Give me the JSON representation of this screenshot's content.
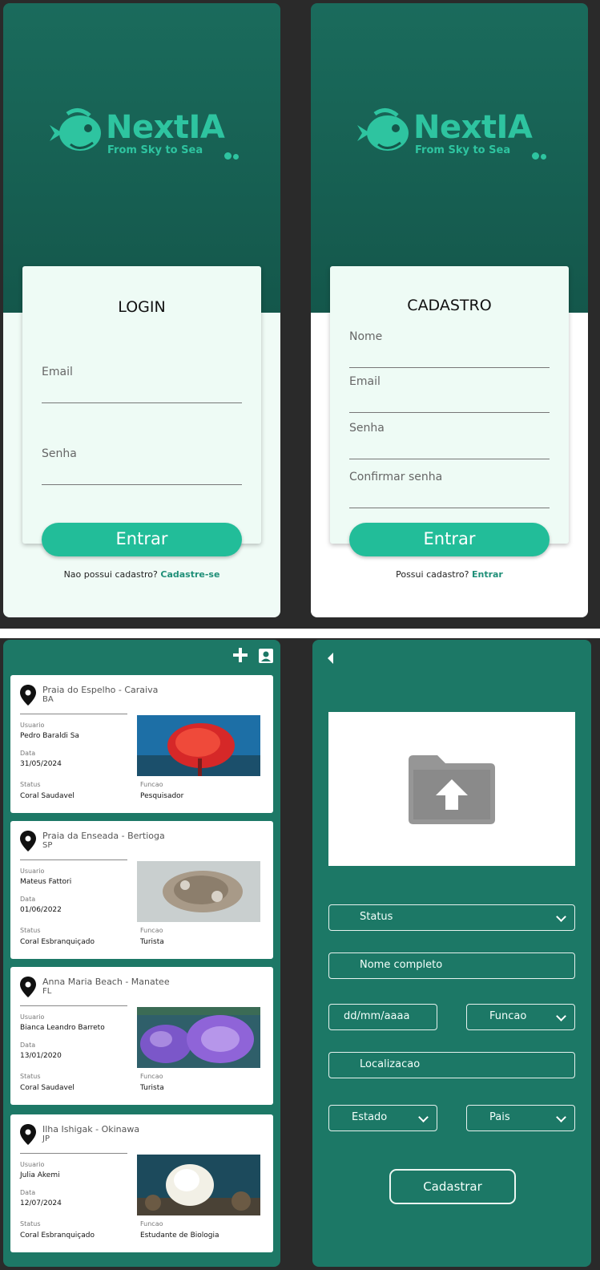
{
  "login": {
    "brand": "NextIA",
    "tagline": "From Sky to Sea",
    "title": "LOGIN",
    "email_label": "Email",
    "password_label": "Senha",
    "button": "Entrar",
    "footer_text": "Nao possui cadastro?",
    "footer_link": "Cadastre-se"
  },
  "register": {
    "brand": "NextIA",
    "tagline": "From Sky to Sea",
    "title": "CADASTRO",
    "name_label": "Nome",
    "email_label": "Email",
    "password_label": "Senha",
    "confirm_label": "Confirmar senha",
    "button": "Entrar",
    "footer_text": "Possui cadastro?",
    "footer_link": "Entrar"
  },
  "records": [
    {
      "location": "Praia do Espelho - Caraiva",
      "state": "BA",
      "user_label": "Usuario",
      "user": "Pedro Baraldi Sa",
      "date_label": "Data",
      "date": "31/05/2024",
      "status_label": "Status",
      "status": "Coral Saudavel",
      "role_label": "Funcao",
      "role": "Pesquisador"
    },
    {
      "location": "Praia da Enseada - Bertioga",
      "state": "SP",
      "user_label": "Usuario",
      "user": "Mateus Fattori",
      "date_label": "Data",
      "date": "01/06/2022",
      "status_label": "Status",
      "status": "Coral Esbranquiçado",
      "role_label": "Funcao",
      "role": "Turista"
    },
    {
      "location": "Anna Maria Beach - Manatee",
      "state": "FL",
      "user_label": "Usuario",
      "user": "Bianca Leandro Barreto",
      "date_label": "Data",
      "date": "13/01/2020",
      "status_label": "Status",
      "status": "Coral Saudavel",
      "role_label": "Funcao",
      "role": "Turista"
    },
    {
      "location": "Ilha Ishigak - Okinawa",
      "state": "JP",
      "user_label": "Usuario",
      "user": "Julia Akemi",
      "date_label": "Data",
      "date": "12/07/2024",
      "status_label": "Status",
      "status": "Coral Esbranquiçado",
      "role_label": "Funcao",
      "role": "Estudante de Biologia"
    }
  ],
  "form": {
    "status": "Status",
    "full_name": "Nome completo",
    "date": "dd/mm/aaaa",
    "role": "Funcao",
    "location": "Localizacao",
    "state": "Estado",
    "country": "Pais",
    "submit": "Cadastrar"
  },
  "icons": [
    "fish-logo-icon",
    "plus-icon",
    "profile-icon",
    "location-pin-icon",
    "back-arrow-icon",
    "folder-upload-icon",
    "chevron-down-icon"
  ]
}
